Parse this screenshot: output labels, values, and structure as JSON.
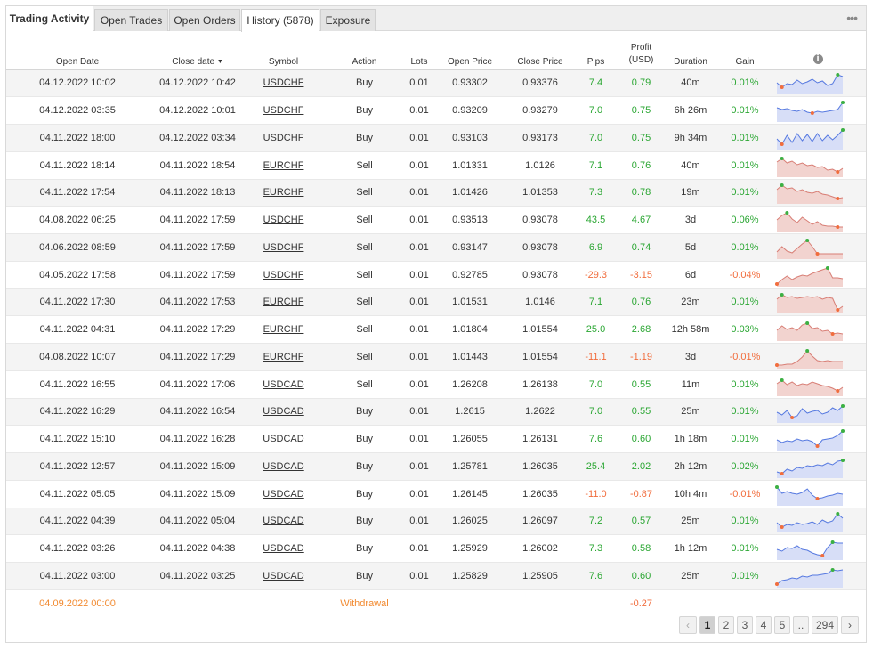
{
  "tabs": [
    {
      "label": "Trading Activity",
      "active": false
    },
    {
      "label": "Open Trades",
      "active": false
    },
    {
      "label": "Open Orders",
      "active": false
    },
    {
      "label": "History (5878)",
      "active": true
    },
    {
      "label": "Exposure",
      "active": false
    }
  ],
  "columns": {
    "open_date": "Open Date",
    "close_date": "Close date",
    "symbol": "Symbol",
    "action": "Action",
    "lots": "Lots",
    "open_price": "Open Price",
    "close_price": "Close Price",
    "pips": "Pips",
    "profit_top": "Profit",
    "profit_bottom": "(USD)",
    "duration": "Duration",
    "gain": "Gain",
    "sort_arrow": "▼",
    "info_icon": "i"
  },
  "colors": {
    "positive": "#2aa632",
    "negative": "#f16d3d",
    "buy_fill": "#d7def7",
    "buy_line": "#5679e0",
    "sell_fill": "#f2d3cf",
    "sell_line": "#d87e75"
  },
  "rows": [
    {
      "open": "04.12.2022 10:02",
      "close": "04.12.2022 10:42",
      "symbol": "USDCHF",
      "action": "Buy",
      "lots": "0.01",
      "open_price": "0.93302",
      "close_price": "0.93376",
      "pips": "7.4",
      "profit": "0.79",
      "duration": "40m",
      "gain": "0.01%",
      "sign": "pos",
      "spark": [
        0.55,
        0.3,
        0.5,
        0.45,
        0.7,
        0.5,
        0.6,
        0.75,
        0.55,
        0.65,
        0.4,
        0.5,
        1.0,
        0.9
      ]
    },
    {
      "open": "04.12.2022 03:35",
      "close": "04.12.2022 10:01",
      "symbol": "USDCHF",
      "action": "Buy",
      "lots": "0.01",
      "open_price": "0.93209",
      "close_price": "0.93279",
      "pips": "7.0",
      "profit": "0.75",
      "duration": "6h 26m",
      "gain": "0.01%",
      "sign": "pos",
      "spark": [
        0.7,
        0.6,
        0.65,
        0.55,
        0.5,
        0.6,
        0.45,
        0.4,
        0.5,
        0.45,
        0.5,
        0.55,
        0.6,
        1.0
      ]
    },
    {
      "open": "04.11.2022 18:00",
      "close": "04.12.2022 03:34",
      "symbol": "USDCHF",
      "action": "Buy",
      "lots": "0.01",
      "open_price": "0.93103",
      "close_price": "0.93173",
      "pips": "7.0",
      "profit": "0.75",
      "duration": "9h 34m",
      "gain": "0.01%",
      "sign": "pos",
      "spark": [
        0.5,
        0.2,
        0.7,
        0.3,
        0.8,
        0.4,
        0.75,
        0.35,
        0.8,
        0.4,
        0.7,
        0.45,
        0.7,
        1.0
      ]
    },
    {
      "open": "04.11.2022 18:14",
      "close": "04.11.2022 18:54",
      "symbol": "EURCHF",
      "action": "Sell",
      "lots": "0.01",
      "open_price": "1.01331",
      "close_price": "1.0126",
      "pips": "7.1",
      "profit": "0.76",
      "duration": "40m",
      "gain": "0.01%",
      "sign": "pos",
      "spark": [
        0.75,
        0.95,
        0.7,
        0.8,
        0.6,
        0.7,
        0.55,
        0.6,
        0.45,
        0.5,
        0.3,
        0.35,
        0.2,
        0.4
      ]
    },
    {
      "open": "04.11.2022 17:54",
      "close": "04.11.2022 18:13",
      "symbol": "EURCHF",
      "action": "Sell",
      "lots": "0.01",
      "open_price": "1.01426",
      "close_price": "1.01353",
      "pips": "7.3",
      "profit": "0.78",
      "duration": "19m",
      "gain": "0.01%",
      "sign": "pos",
      "spark": [
        0.7,
        0.95,
        0.75,
        0.8,
        0.6,
        0.7,
        0.55,
        0.5,
        0.6,
        0.45,
        0.4,
        0.3,
        0.2,
        0.25
      ]
    },
    {
      "open": "04.08.2022 06:25",
      "close": "04.11.2022 17:59",
      "symbol": "USDCHF",
      "action": "Sell",
      "lots": "0.01",
      "open_price": "0.93513",
      "close_price": "0.93078",
      "pips": "43.5",
      "profit": "4.67",
      "duration": "3d",
      "gain": "0.06%",
      "sign": "pos",
      "spark": [
        0.55,
        0.8,
        0.95,
        0.6,
        0.4,
        0.7,
        0.5,
        0.3,
        0.45,
        0.25,
        0.2,
        0.2,
        0.15,
        0.15
      ]
    },
    {
      "open": "04.06.2022 08:59",
      "close": "04.11.2022 17:59",
      "symbol": "USDCHF",
      "action": "Sell",
      "lots": "0.01",
      "open_price": "0.93147",
      "close_price": "0.93078",
      "pips": "6.9",
      "profit": "0.74",
      "duration": "5d",
      "gain": "0.01%",
      "sign": "pos",
      "spark": [
        0.3,
        0.6,
        0.35,
        0.25,
        0.5,
        0.75,
        0.95,
        0.6,
        0.2,
        0.2,
        0.2,
        0.2,
        0.2,
        0.2
      ]
    },
    {
      "open": "04.05.2022 17:58",
      "close": "04.11.2022 17:59",
      "symbol": "USDCHF",
      "action": "Sell",
      "lots": "0.01",
      "open_price": "0.92785",
      "close_price": "0.93078",
      "pips": "-29.3",
      "profit": "-3.15",
      "duration": "6d",
      "gain": "-0.04%",
      "sign": "neg",
      "spark": [
        0.05,
        0.3,
        0.5,
        0.3,
        0.45,
        0.55,
        0.5,
        0.65,
        0.75,
        0.85,
        0.95,
        0.4,
        0.4,
        0.35
      ]
    },
    {
      "open": "04.11.2022 17:30",
      "close": "04.11.2022 17:53",
      "symbol": "EURCHF",
      "action": "Sell",
      "lots": "0.01",
      "open_price": "1.01531",
      "close_price": "1.0146",
      "pips": "7.1",
      "profit": "0.76",
      "duration": "23m",
      "gain": "0.01%",
      "sign": "pos",
      "spark": [
        0.7,
        0.95,
        0.8,
        0.85,
        0.75,
        0.8,
        0.85,
        0.8,
        0.85,
        0.7,
        0.8,
        0.75,
        0.1,
        0.3
      ]
    },
    {
      "open": "04.11.2022 04:31",
      "close": "04.11.2022 17:29",
      "symbol": "EURCHF",
      "action": "Sell",
      "lots": "0.01",
      "open_price": "1.01804",
      "close_price": "1.01554",
      "pips": "25.0",
      "profit": "2.68",
      "duration": "12h 58m",
      "gain": "0.03%",
      "sign": "pos",
      "spark": [
        0.5,
        0.75,
        0.55,
        0.65,
        0.5,
        0.8,
        0.9,
        0.6,
        0.65,
        0.45,
        0.5,
        0.3,
        0.35,
        0.3
      ]
    },
    {
      "open": "04.08.2022 10:07",
      "close": "04.11.2022 17:29",
      "symbol": "EURCHF",
      "action": "Sell",
      "lots": "0.01",
      "open_price": "1.01443",
      "close_price": "1.01554",
      "pips": "-11.1",
      "profit": "-1.19",
      "duration": "3d",
      "gain": "-0.01%",
      "sign": "neg",
      "spark": [
        0.1,
        0.1,
        0.15,
        0.15,
        0.3,
        0.55,
        0.9,
        0.6,
        0.35,
        0.3,
        0.35,
        0.3,
        0.3,
        0.3
      ]
    },
    {
      "open": "04.11.2022 16:55",
      "close": "04.11.2022 17:06",
      "symbol": "USDCAD",
      "action": "Sell",
      "lots": "0.01",
      "open_price": "1.26208",
      "close_price": "1.26138",
      "pips": "7.0",
      "profit": "0.55",
      "duration": "11m",
      "gain": "0.01%",
      "sign": "pos",
      "spark": [
        0.6,
        0.8,
        0.55,
        0.7,
        0.5,
        0.6,
        0.55,
        0.7,
        0.6,
        0.5,
        0.45,
        0.35,
        0.2,
        0.4
      ]
    },
    {
      "open": "04.11.2022 16:29",
      "close": "04.11.2022 16:54",
      "symbol": "USDCAD",
      "action": "Buy",
      "lots": "0.01",
      "open_price": "1.2615",
      "close_price": "1.2622",
      "pips": "7.0",
      "profit": "0.55",
      "duration": "25m",
      "gain": "0.01%",
      "sign": "pos",
      "spark": [
        0.5,
        0.35,
        0.6,
        0.2,
        0.3,
        0.7,
        0.45,
        0.55,
        0.6,
        0.4,
        0.5,
        0.75,
        0.6,
        0.85
      ]
    },
    {
      "open": "04.11.2022 15:10",
      "close": "04.11.2022 16:28",
      "symbol": "USDCAD",
      "action": "Buy",
      "lots": "0.01",
      "open_price": "1.26055",
      "close_price": "1.26131",
      "pips": "7.6",
      "profit": "0.60",
      "duration": "1h 18m",
      "gain": "0.01%",
      "sign": "pos",
      "spark": [
        0.5,
        0.35,
        0.45,
        0.4,
        0.55,
        0.45,
        0.5,
        0.4,
        0.15,
        0.5,
        0.55,
        0.6,
        0.75,
        1.0
      ]
    },
    {
      "open": "04.11.2022 12:57",
      "close": "04.11.2022 15:09",
      "symbol": "USDCAD",
      "action": "Buy",
      "lots": "0.01",
      "open_price": "1.25781",
      "close_price": "1.26035",
      "pips": "25.4",
      "profit": "2.02",
      "duration": "2h 12m",
      "gain": "0.02%",
      "sign": "pos",
      "spark": [
        0.25,
        0.15,
        0.4,
        0.3,
        0.5,
        0.45,
        0.6,
        0.55,
        0.65,
        0.6,
        0.75,
        0.65,
        0.85,
        0.9
      ]
    },
    {
      "open": "04.11.2022 05:05",
      "close": "04.11.2022 15:09",
      "symbol": "USDCAD",
      "action": "Buy",
      "lots": "0.01",
      "open_price": "1.26145",
      "close_price": "1.26035",
      "pips": "-11.0",
      "profit": "-0.87",
      "duration": "10h 4m",
      "gain": "-0.01%",
      "sign": "neg",
      "spark": [
        0.95,
        0.6,
        0.7,
        0.6,
        0.55,
        0.65,
        0.85,
        0.5,
        0.3,
        0.35,
        0.45,
        0.5,
        0.6,
        0.55
      ]
    },
    {
      "open": "04.11.2022 04:39",
      "close": "04.11.2022 05:04",
      "symbol": "USDCAD",
      "action": "Buy",
      "lots": "0.01",
      "open_price": "1.26025",
      "close_price": "1.26097",
      "pips": "7.2",
      "profit": "0.57",
      "duration": "25m",
      "gain": "0.01%",
      "sign": "pos",
      "spark": [
        0.45,
        0.2,
        0.35,
        0.3,
        0.45,
        0.35,
        0.4,
        0.5,
        0.35,
        0.6,
        0.45,
        0.55,
        0.95,
        0.7
      ]
    },
    {
      "open": "04.11.2022 03:26",
      "close": "04.11.2022 04:38",
      "symbol": "USDCAD",
      "action": "Buy",
      "lots": "0.01",
      "open_price": "1.25929",
      "close_price": "1.26002",
      "pips": "7.3",
      "profit": "0.58",
      "duration": "1h 12m",
      "gain": "0.01%",
      "sign": "pos",
      "spark": [
        0.5,
        0.4,
        0.6,
        0.55,
        0.7,
        0.5,
        0.45,
        0.3,
        0.2,
        0.15,
        0.6,
        0.9,
        0.85,
        0.85
      ]
    },
    {
      "open": "04.11.2022 03:00",
      "close": "04.11.2022 03:25",
      "symbol": "USDCAD",
      "action": "Buy",
      "lots": "0.01",
      "open_price": "1.25829",
      "close_price": "1.25905",
      "pips": "7.6",
      "profit": "0.60",
      "duration": "25m",
      "gain": "0.01%",
      "sign": "pos",
      "spark": [
        0.1,
        0.3,
        0.35,
        0.45,
        0.4,
        0.55,
        0.5,
        0.6,
        0.6,
        0.65,
        0.7,
        0.9,
        0.85,
        0.9
      ]
    }
  ],
  "withdrawal": {
    "date": "04.09.2022 00:00",
    "label": "Withdrawal",
    "profit": "-0.27"
  },
  "pagination": {
    "prev": "‹",
    "pages": [
      "1",
      "2",
      "3",
      "4",
      "5"
    ],
    "ellipsis": "..",
    "last": "294",
    "next": "›",
    "current": "1"
  }
}
